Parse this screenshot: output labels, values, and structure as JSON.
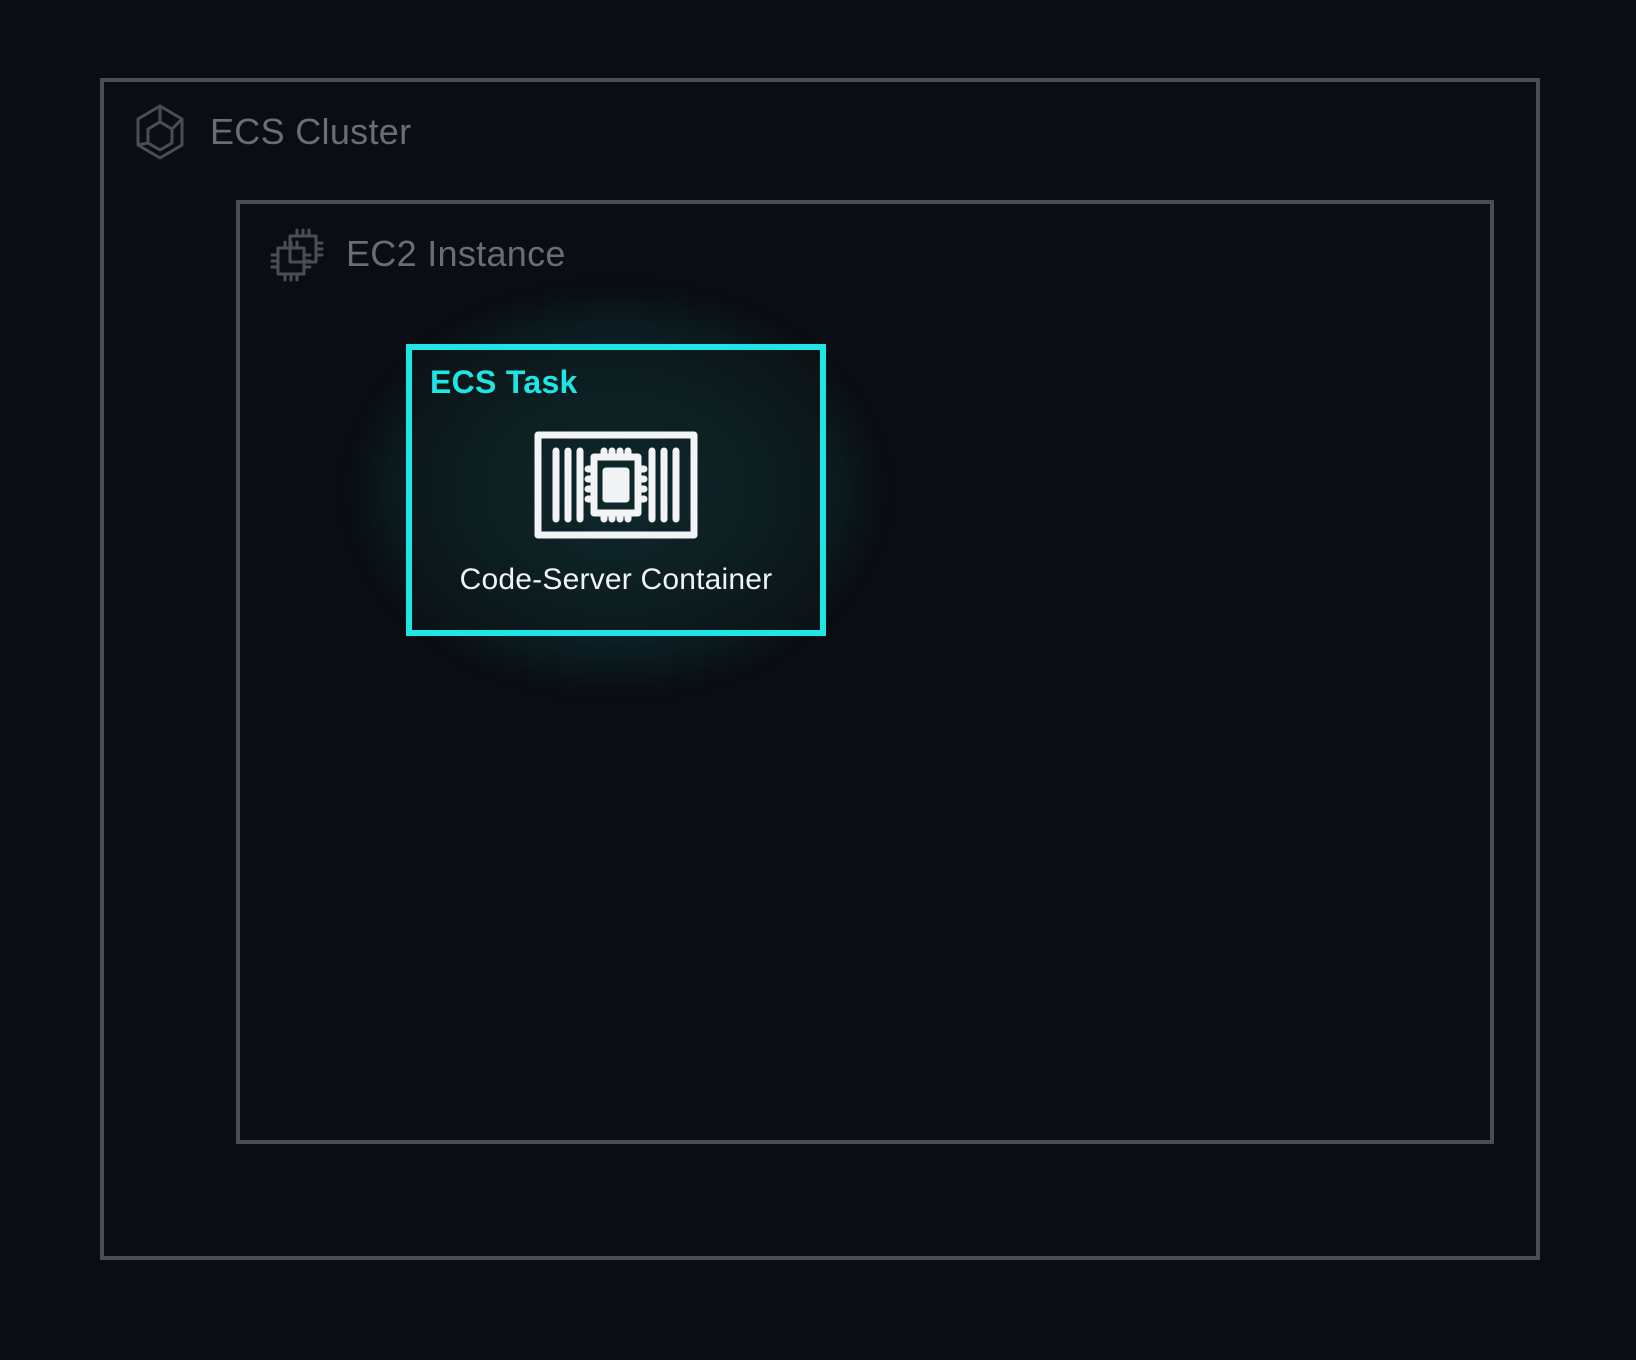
{
  "diagram": {
    "cluster": {
      "label": "ECS Cluster",
      "icon_name": "ecs-cluster-icon"
    },
    "ec2": {
      "label": "EC2 Instance",
      "icon_name": "ec2-chip-icon"
    },
    "task": {
      "label": "ECS Task",
      "container_label": "Code-Server Container",
      "icon_name": "container-barcode-icon"
    }
  },
  "colors": {
    "background": "#0a0d12",
    "muted_border": "#4a4d52",
    "muted_text": "#6a6d72",
    "accent": "#1fe5e5",
    "white": "#f2f3f5"
  }
}
